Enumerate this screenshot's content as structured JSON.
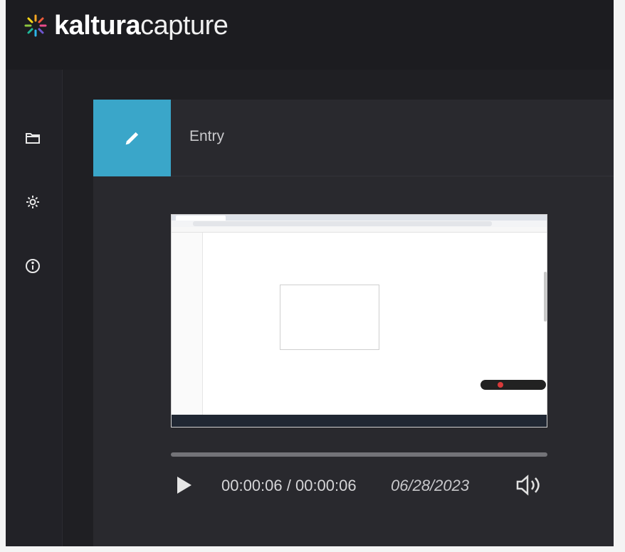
{
  "app": {
    "brand": "kaltura",
    "product": "capture",
    "logo_icon": "kaltura-spark-icon",
    "accent_color": "#3aa6c9"
  },
  "sidebar": {
    "items": [
      {
        "icon": "folder-icon"
      },
      {
        "icon": "gear-icon"
      },
      {
        "icon": "info-icon"
      }
    ]
  },
  "entry": {
    "edit_icon": "pencil-icon",
    "title": "Entry"
  },
  "player": {
    "progress": 1.0,
    "time_display": "00:00:06 / 00:00:06",
    "date": "06/28/2023",
    "play_icon": "play-icon",
    "volume_icon": "volume-icon"
  }
}
